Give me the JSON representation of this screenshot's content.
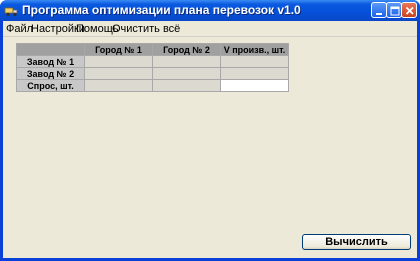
{
  "window": {
    "title": "Программа оптимизации плана перевозок v1.0"
  },
  "menu": {
    "items": [
      "Файл",
      "Настройки",
      "Помощь",
      "Очистить всё"
    ]
  },
  "table": {
    "corner": "",
    "columns": [
      "Город № 1",
      "Город № 2",
      "V произв., шт."
    ],
    "rows": [
      {
        "label": "Завод № 1",
        "cells": [
          "",
          "",
          ""
        ]
      },
      {
        "label": "Завод № 2",
        "cells": [
          "",
          "",
          ""
        ]
      },
      {
        "label": "Спрос, шт.",
        "cells": [
          "",
          "",
          ""
        ]
      }
    ]
  },
  "buttons": {
    "calculate": "Вычислить"
  },
  "colors": {
    "titlebar": "#0550d8",
    "client_bg": "#ece9d8",
    "header_cell": "#a0a0a0",
    "row_header_cell": "#c8c8c8",
    "data_cell": "#dcdad0"
  }
}
